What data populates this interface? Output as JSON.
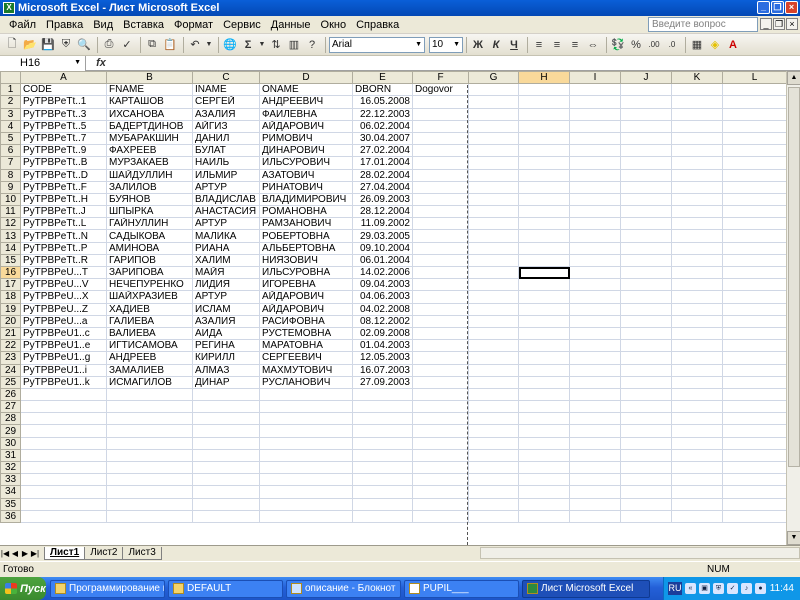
{
  "window": {
    "title": "Microsoft Excel - Лист Microsoft Excel"
  },
  "menu": [
    "Файл",
    "Правка",
    "Вид",
    "Вставка",
    "Формат",
    "Сервис",
    "Данные",
    "Окно",
    "Справка"
  ],
  "help_placeholder": "Введите вопрос",
  "toolbar": {
    "font": "Arial",
    "size": "10"
  },
  "formula": {
    "namebox": "H16",
    "fx": "fx",
    "content": ""
  },
  "columns": [
    "A",
    "B",
    "C",
    "D",
    "E",
    "F",
    "G",
    "H",
    "I",
    "J",
    "K",
    "L"
  ],
  "selected": {
    "row": 16,
    "col": "H"
  },
  "rows": [
    [
      "CODE",
      "FNAME",
      "INAME",
      "ONAME",
      "DBORN",
      "Dogovor"
    ],
    [
      "PyTPBPeTt..1",
      "КАРТАШОВ",
      "СЕРГЕЙ",
      "АНДРЕЕВИЧ",
      "16.05.2008",
      ""
    ],
    [
      "PyTPBPeTt..3",
      "ИХСАНОВА",
      "АЗАЛИЯ",
      "ФАИЛЕВНА",
      "22.12.2003",
      ""
    ],
    [
      "PyTPBPeTt..5",
      "БАДЕРТДИНОВ",
      "АЙГИЗ",
      "АЙДАРОВИЧ",
      "06.02.2004",
      ""
    ],
    [
      "PyTPBPeTt..7",
      "МУБАРАКШИН",
      "ДАНИЛ",
      "РИМОВИЧ",
      "30.04.2007",
      ""
    ],
    [
      "PyTPBPeTt..9",
      "ФАХРЕЕВ",
      "БУЛАТ",
      "ДИНАРОВИЧ",
      "27.02.2004",
      ""
    ],
    [
      "PyTPBPeTt..B",
      "МУРЗАКАЕВ",
      "НАИЛЬ",
      "ИЛЬСУРОВИЧ",
      "17.01.2004",
      ""
    ],
    [
      "PyTPBPeTt..D",
      "ШАЙДУЛЛИН",
      "ИЛЬМИР",
      "АЗАТОВИЧ",
      "28.02.2004",
      ""
    ],
    [
      "PyTPBPeTt..F",
      "ЗАЛИЛОВ",
      "АРТУР",
      "РИНАТОВИЧ",
      "27.04.2004",
      ""
    ],
    [
      "PyTPBPeTt..H",
      "БУЯНОВ",
      "ВЛАДИСЛАВ",
      "ВЛАДИМИРОВИЧ",
      "26.09.2003",
      ""
    ],
    [
      "PyTPBPeTt..J",
      "ШПЫРКА",
      "АНАСТАСИЯ",
      "РОМАНОВНА",
      "28.12.2004",
      ""
    ],
    [
      "PyTPBPeTt..L",
      "ГАЙНУЛЛИН",
      "АРТУР",
      "РАМЗАНОВИЧ",
      "11.09.2002",
      ""
    ],
    [
      "PyTPBPeTt..N",
      "САДЫКОВА",
      "МАЛИКА",
      "РОБЕРТОВНА",
      "29.03.2005",
      ""
    ],
    [
      "PyTPBPeTt..P",
      "АМИНОВА",
      "РИАНА",
      "АЛЬБЕРТОВНА",
      "09.10.2004",
      ""
    ],
    [
      "PyTPBPeTt..R",
      "ГАРИПОВ",
      "ХАЛИМ",
      "НИЯЗОВИЧ",
      "06.01.2004",
      ""
    ],
    [
      "PyTPBPeU...T",
      "ЗАРИПОВА",
      "МАЙЯ",
      "ИЛЬСУРОВНА",
      "14.02.2006",
      ""
    ],
    [
      "PyTPBPeU...V",
      "НЕЧЕПУРЕНКО",
      "ЛИДИЯ",
      "ИГОРЕВНА",
      "09.04.2003",
      ""
    ],
    [
      "PyTPBPeU...X",
      "ШАЙХРАЗИЕВ",
      "АРТУР",
      "АЙДАРОВИЧ",
      "04.06.2003",
      ""
    ],
    [
      "PyTPBPeU...Z",
      "ХАДИЕВ",
      "ИСЛАМ",
      "АЙДАРОВИЧ",
      "04.02.2008",
      ""
    ],
    [
      "PyTPBPeU...a",
      "ГАЛИЕВА",
      "АЗАЛИЯ",
      "РАСИФОВНА",
      "08.12.2002",
      ""
    ],
    [
      "PyTPBPeU1..c",
      "ВАЛИЕВА",
      "АИДА",
      "РУСТЕМОВНА",
      "02.09.2008",
      ""
    ],
    [
      "PyTPBPeU1..e",
      "ИГТИСАМОВА",
      "РЕГИНА",
      "МАРАТОВНА",
      "01.04.2003",
      ""
    ],
    [
      "PyTPBPeU1..g",
      "АНДРЕЕВ",
      "КИРИЛЛ",
      "СЕРГЕЕВИЧ",
      "12.05.2003",
      ""
    ],
    [
      "PyTPBPeU1..i",
      "ЗАМАЛИЕВ",
      "АЛМАЗ",
      "МАХМУТОВИЧ",
      "16.07.2003",
      ""
    ],
    [
      "PyTPBPeU1..k",
      "ИСМАГИЛОВ",
      "ДИНАР",
      "РУСЛАНОВИЧ",
      "27.09.2003",
      ""
    ]
  ],
  "empty_rows": [
    "26",
    "27",
    "28",
    "29",
    "30",
    "31",
    "32",
    "33",
    "34",
    "35",
    "36"
  ],
  "sheets": [
    "Лист1",
    "Лист2",
    "Лист3"
  ],
  "status": {
    "left": "Готово",
    "num": "NUM"
  },
  "taskbar": {
    "start": "Пуск",
    "items": [
      "Программирование на...",
      "DEFAULT",
      "описание - Блокнот",
      "PUPIL___",
      "Лист Microsoft Excel"
    ],
    "lang": "RU",
    "clock": "11:44"
  }
}
